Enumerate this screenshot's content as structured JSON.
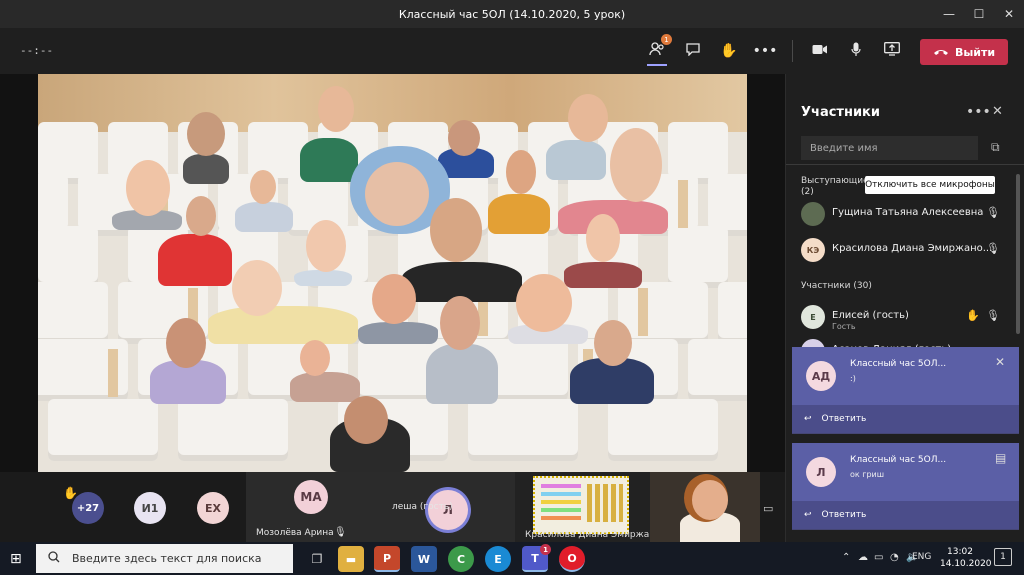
{
  "window": {
    "title": "Классный час 5ОЛ (14.10.2020, 5 урок)",
    "minimize": "—",
    "maximize": "☐",
    "close": "✕"
  },
  "toolbar": {
    "timer": "--:--",
    "participants_badge": "1",
    "leave_label": "Выйти"
  },
  "participants_panel": {
    "title": "Участники",
    "search_placeholder": "Введите имя",
    "presenters_header": "Выступающие",
    "presenters_count": "(2)",
    "mute_all_label": "Отключить все микрофоны",
    "presenters": [
      {
        "name": "Гущина Татьяна Алексеевна",
        "initials": ""
      },
      {
        "name": "Красилова Диана Эмиржано...",
        "initials": "КЭ"
      }
    ],
    "attendees_header": "Участники (30)",
    "attendees": [
      {
        "name": "Елисей (гость)",
        "initials": "Е",
        "role": "Гость"
      },
      {
        "name": "Асанов Даниял (гость)",
        "initials": ""
      }
    ]
  },
  "notifications": [
    {
      "initials": "АД",
      "title": "Классный час 5ОЛ...",
      "message": ":)",
      "reply_label": "Ответить"
    },
    {
      "initials": "Л",
      "title": "Классный час 5ОЛ...",
      "message": "ок гриш",
      "reply_label": "Ответить"
    }
  ],
  "bottom_strip": {
    "overflow_count": "+27",
    "avatars": [
      "И1",
      "ЕХ"
    ],
    "tiles": [
      {
        "initials": "МА",
        "name": "Мозолёва Арина"
      },
      {
        "initials": "Л",
        "name": "леша (гость)"
      },
      {
        "name": "Красилова Диана Эмиржа..."
      }
    ]
  },
  "taskbar": {
    "search_placeholder": "Введите здесь текст для поиска",
    "apps": [
      "P",
      "W",
      "C",
      "E",
      "T",
      "O"
    ],
    "teams_badge": "1",
    "language": "ENG",
    "time": "13:02",
    "date": "14.10.2020",
    "notification_count": "1"
  },
  "colors": {
    "leave": "#c4314b",
    "toast": "#5b5fa6",
    "accent": "#9ea2ff",
    "taskbar": "#151a24"
  }
}
